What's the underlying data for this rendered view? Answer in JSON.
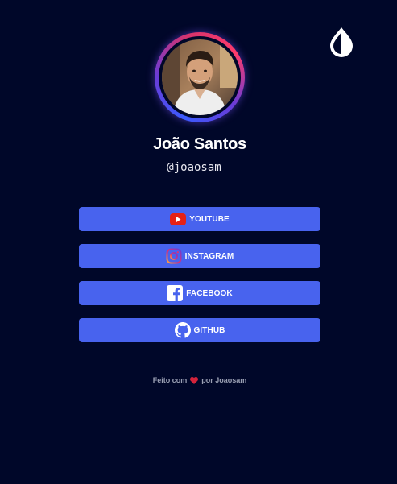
{
  "profile": {
    "name": "João Santos",
    "handle": "@joaosam"
  },
  "links": [
    {
      "label": "YOUTUBE",
      "icon": "youtube-icon"
    },
    {
      "label": "INSTAGRAM",
      "icon": "instagram-icon"
    },
    {
      "label": "FACEBOOK",
      "icon": "facebook-icon"
    },
    {
      "label": "GITHUB",
      "icon": "github-icon"
    }
  ],
  "footer": {
    "prefix": "Feito com",
    "suffix": "por Joaosam",
    "icon": "heart-icon"
  },
  "theme_toggle": {
    "icon": "water-drop-icon"
  },
  "colors": {
    "background": "#000729",
    "button": "#4863ee",
    "heart": "#d3233b",
    "youtube": "#e62117"
  }
}
